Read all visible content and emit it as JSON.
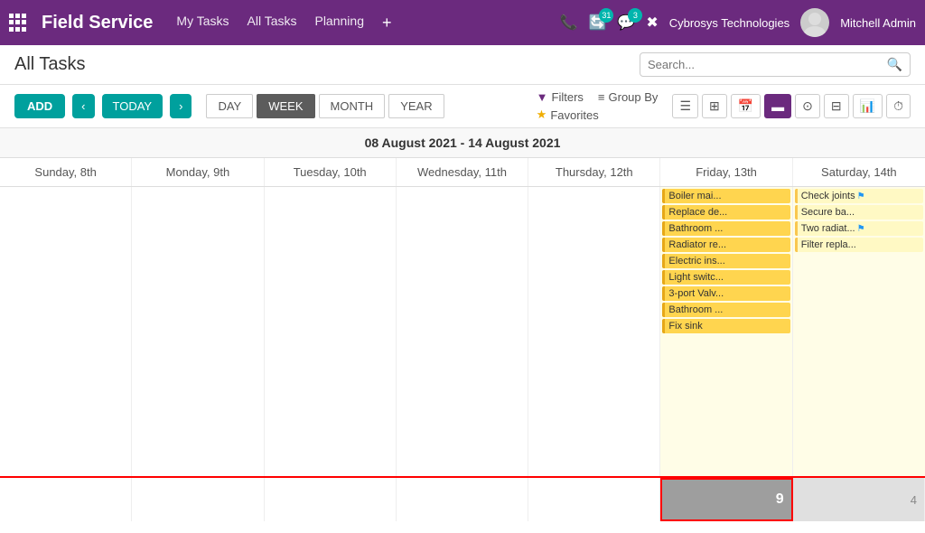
{
  "app": {
    "title": "Field Service",
    "grid_icon": "grid-icon"
  },
  "topnav": {
    "menu": [
      "My Tasks",
      "All Tasks",
      "Planning"
    ],
    "plus_label": "+",
    "icons": {
      "phone": "📞",
      "activity_count": "31",
      "chat_count": "3"
    },
    "company": "Cybrosys Technologies",
    "user": "Mitchell Admin"
  },
  "subheader": {
    "page_title": "All Tasks",
    "search_placeholder": "Search..."
  },
  "toolbar": {
    "add_label": "ADD",
    "prev_label": "‹",
    "today_label": "TODAY",
    "next_label": "›",
    "view_tabs": [
      "DAY",
      "WEEK",
      "MONTH",
      "YEAR"
    ],
    "active_tab": "WEEK",
    "filters_label": "Filters",
    "group_by_label": "Group By",
    "favorites_label": "Favorites"
  },
  "calendar": {
    "week_label": "08 August 2021 - 14 August 2021",
    "days": [
      {
        "label": "Sunday, 8th",
        "highlighted": false
      },
      {
        "label": "Monday, 9th",
        "highlighted": false
      },
      {
        "label": "Tuesday, 10th",
        "highlighted": false
      },
      {
        "label": "Wednesday, 11th",
        "highlighted": false
      },
      {
        "label": "Thursday, 12th",
        "highlighted": false
      },
      {
        "label": "Friday, 13th",
        "highlighted": true
      },
      {
        "label": "Saturday, 14th",
        "highlighted": false
      }
    ],
    "friday_tasks": [
      "Boiler mai...",
      "Replace de...",
      "Bathroom ...",
      "Radiator re...",
      "Electric ins...",
      "Light switc...",
      "3-port Valv...",
      "Bathroom ...",
      "Fix sink"
    ],
    "saturday_tasks": [
      "Check joints",
      "Secure ba...",
      "Two radiat...",
      "Filter repla..."
    ],
    "footer_friday_count": "9",
    "footer_saturday_count": "4"
  }
}
